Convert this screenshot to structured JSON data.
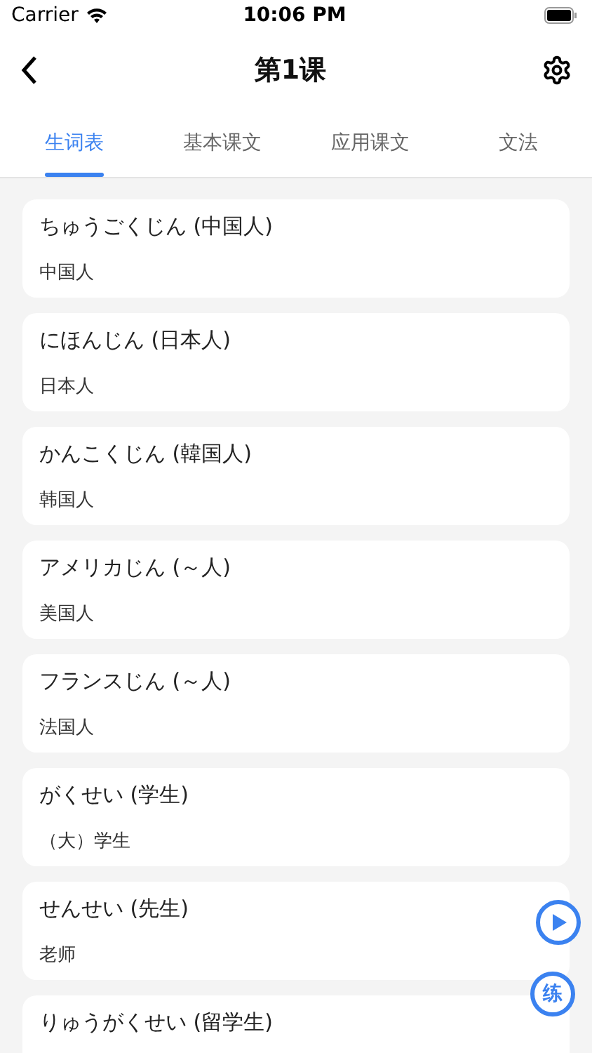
{
  "status_bar": {
    "carrier": "Carrier",
    "time": "10:06 PM"
  },
  "nav": {
    "title": "第1课"
  },
  "tabs": [
    {
      "label": "生词表",
      "selected": true
    },
    {
      "label": "基本课文",
      "selected": false
    },
    {
      "label": "应用课文",
      "selected": false
    },
    {
      "label": "文法",
      "selected": false
    }
  ],
  "words": [
    {
      "reading": "ちゅうごくじん (中国人)",
      "meaning": "中国人"
    },
    {
      "reading": "にほんじん (日本人)",
      "meaning": "日本人"
    },
    {
      "reading": "かんこくじん (韓国人)",
      "meaning": "韩国人"
    },
    {
      "reading": "アメリカじん (～人)",
      "meaning": "美国人"
    },
    {
      "reading": "フランスじん (～人)",
      "meaning": "法国人"
    },
    {
      "reading": "がくせい (学生)",
      "meaning": "（大）学生"
    },
    {
      "reading": "せんせい (先生)",
      "meaning": "老师"
    },
    {
      "reading": "りゅうがくせい (留学生)"
    }
  ],
  "practice_button": {
    "label": "练"
  }
}
